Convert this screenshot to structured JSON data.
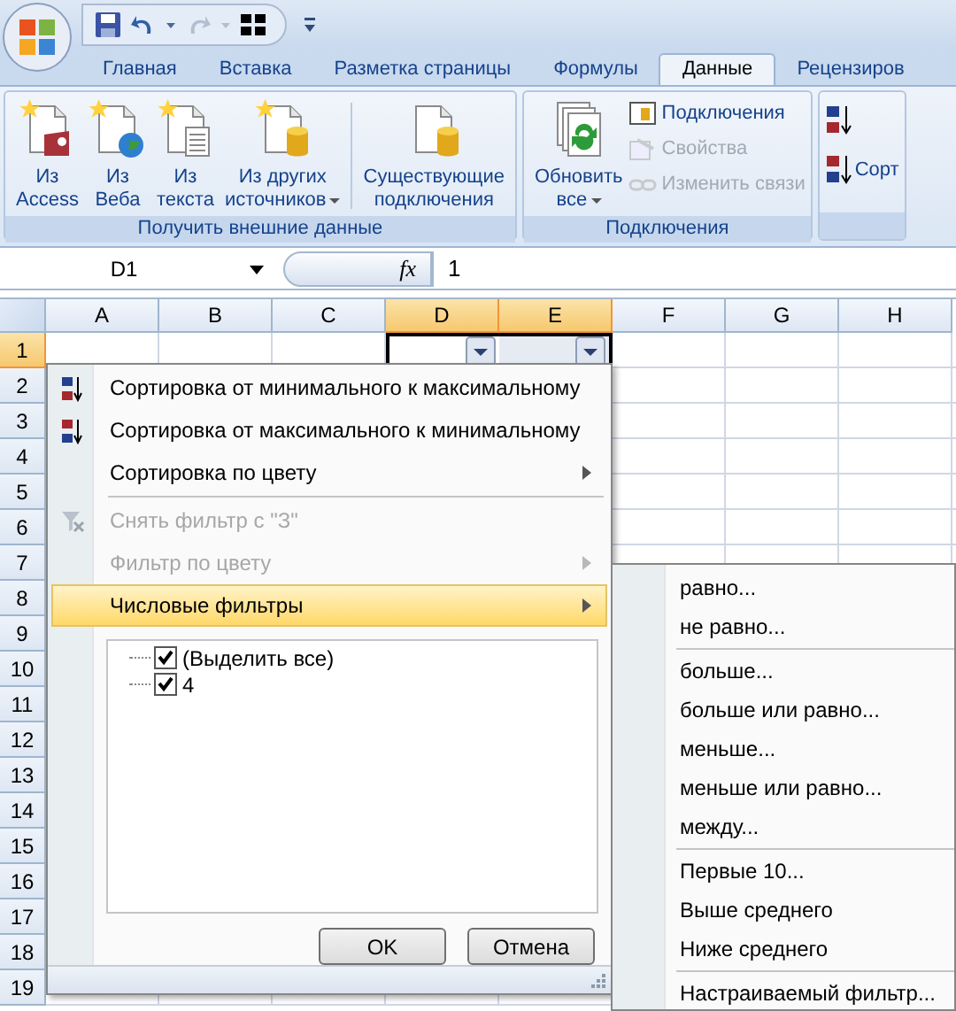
{
  "tabs": [
    {
      "label": "Главная",
      "selected": false
    },
    {
      "label": "Вставка",
      "selected": false
    },
    {
      "label": "Разметка страницы",
      "selected": false
    },
    {
      "label": "Формулы",
      "selected": false
    },
    {
      "label": "Данные",
      "selected": true
    },
    {
      "label": "Рецензиров",
      "selected": false
    }
  ],
  "ribbon_groups": [
    {
      "title": "Получить внешние данные",
      "items": [
        {
          "kind": "large",
          "lines": [
            "Из",
            "Access"
          ],
          "dropdown": false
        },
        {
          "kind": "large",
          "lines": [
            "Из",
            "Веба"
          ],
          "dropdown": false
        },
        {
          "kind": "large",
          "lines": [
            "Из",
            "текста"
          ],
          "dropdown": false
        },
        {
          "kind": "large",
          "lines": [
            "Из других",
            "источников"
          ],
          "dropdown": true
        },
        {
          "kind": "divider"
        },
        {
          "kind": "large",
          "lines": [
            "Существующие",
            "подключения"
          ],
          "dropdown": false
        }
      ]
    },
    {
      "title": "Подключения",
      "items": [
        {
          "kind": "large",
          "lines": [
            "Обновить",
            "все"
          ],
          "dropdown": true
        },
        {
          "kind": "stack",
          "items": [
            {
              "label": "Подключения",
              "disabled": false
            },
            {
              "label": "Свойства",
              "disabled": true
            },
            {
              "label": "Изменить связи",
              "disabled": true
            }
          ]
        }
      ]
    },
    {
      "items": [
        {
          "kind": "sort",
          "label": "Сорт"
        }
      ]
    }
  ],
  "formula_bar": {
    "name_box": "D1",
    "function_label": "fx",
    "value": "1"
  },
  "columns": [
    {
      "label": "A",
      "selected": false
    },
    {
      "label": "B",
      "selected": false
    },
    {
      "label": "C",
      "selected": false
    },
    {
      "label": "D",
      "selected": true
    },
    {
      "label": "E",
      "selected": true
    },
    {
      "label": "F",
      "selected": false
    },
    {
      "label": "G",
      "selected": false
    },
    {
      "label": "H",
      "selected": false
    }
  ],
  "rows": [
    {
      "label": "1",
      "selected": true
    },
    {
      "label": "2",
      "selected": false
    },
    {
      "label": "3",
      "selected": false
    },
    {
      "label": "4",
      "selected": false
    },
    {
      "label": "5",
      "selected": false
    },
    {
      "label": "6",
      "selected": false
    },
    {
      "label": "7",
      "selected": false
    },
    {
      "label": "8",
      "selected": false
    },
    {
      "label": "9",
      "selected": false
    },
    {
      "label": "10",
      "selected": false
    },
    {
      "label": "11",
      "selected": false
    },
    {
      "label": "12",
      "selected": false
    },
    {
      "label": "13",
      "selected": false
    },
    {
      "label": "14",
      "selected": false
    },
    {
      "label": "15",
      "selected": false
    },
    {
      "label": "16",
      "selected": false
    },
    {
      "label": "17",
      "selected": false
    },
    {
      "label": "18",
      "selected": false
    },
    {
      "label": "19",
      "selected": false
    }
  ],
  "filter_menu": {
    "items": [
      {
        "kind": "item",
        "label": "Сортировка от минимального к максимальному",
        "disabled": false,
        "submenu": false,
        "highlighted": false
      },
      {
        "kind": "item",
        "label": "Сортировка от максимального к минимальному",
        "disabled": false,
        "submenu": false,
        "highlighted": false
      },
      {
        "kind": "item",
        "label": "Сортировка по цвету",
        "disabled": false,
        "submenu": true,
        "highlighted": false
      },
      {
        "kind": "separator"
      },
      {
        "kind": "item",
        "label": "Снять фильтр с \"З\"",
        "disabled": true,
        "submenu": false,
        "highlighted": false
      },
      {
        "kind": "item",
        "label": "Фильтр по цвету",
        "disabled": true,
        "submenu": true,
        "highlighted": false
      },
      {
        "kind": "item",
        "label": "Числовые фильтры",
        "disabled": false,
        "submenu": true,
        "highlighted": true
      }
    ],
    "values": [
      {
        "label": "(Выделить все)",
        "checked": true
      },
      {
        "label": "4",
        "checked": true
      }
    ],
    "buttons": [
      "OK",
      "Отмена"
    ]
  },
  "submenu": {
    "items": [
      {
        "kind": "item",
        "label": "равно..."
      },
      {
        "kind": "item",
        "label": "не равно..."
      },
      {
        "kind": "separator"
      },
      {
        "kind": "item",
        "label": "больше..."
      },
      {
        "kind": "item",
        "label": "больше или равно..."
      },
      {
        "kind": "item",
        "label": "меньше..."
      },
      {
        "kind": "item",
        "label": "меньше или равно..."
      },
      {
        "kind": "item",
        "label": "между..."
      },
      {
        "kind": "separator"
      },
      {
        "kind": "item",
        "label": "Первые 10..."
      },
      {
        "kind": "item",
        "label": "Выше среднего"
      },
      {
        "kind": "item",
        "label": "Ниже среднего"
      },
      {
        "kind": "separator"
      },
      {
        "kind": "item",
        "label": "Настраиваемый фильтр..."
      }
    ]
  }
}
